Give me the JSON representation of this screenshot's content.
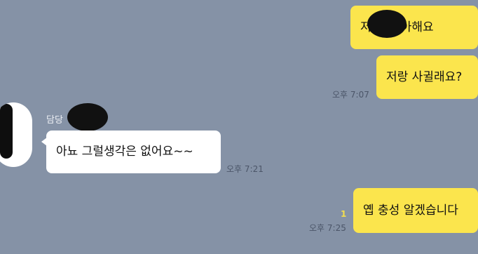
{
  "colors": {
    "background": "#8592a6",
    "my_bubble": "#fbe54d",
    "other_bubble": "#ffffff",
    "time_text": "#4b5568",
    "read_indicator": "#f2de4f"
  },
  "messages": [
    {
      "sender": "me",
      "text": "저        씨 좋아해요",
      "time": ""
    },
    {
      "sender": "me",
      "text": "저랑 사귈래요?",
      "time": "오후 7:07"
    },
    {
      "sender": "other",
      "sender_name": "담당",
      "text": "아뇨 그럴생각은 없어요~~",
      "time": "오후 7:21"
    },
    {
      "sender": "me",
      "text": "옙 충성 알겠습니다",
      "time": "오후 7:25",
      "unread_count": "1"
    }
  ]
}
